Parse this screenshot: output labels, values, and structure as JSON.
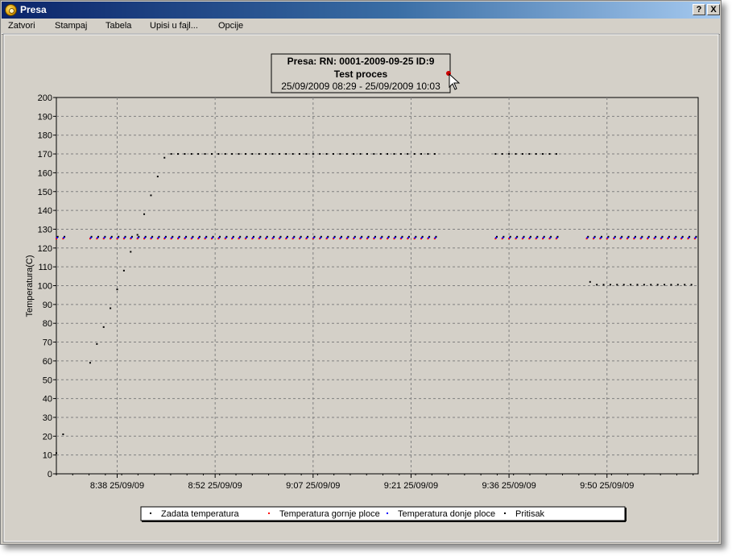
{
  "window": {
    "title": "Presa",
    "help_button": "?",
    "close_button": "X"
  },
  "menu": [
    {
      "label": "Zatvori"
    },
    {
      "label": "Stampaj"
    },
    {
      "label": "Tabela"
    },
    {
      "label": "Upisi u fajl..."
    },
    {
      "label": "Opcije"
    }
  ],
  "chart_data": {
    "type": "scatter",
    "title_lines": [
      "Presa: RN: 0001-2009-09-25 ID:9",
      "Test proces",
      "25/09/2009 08:29 - 25/09/2009 10:03"
    ],
    "ylabel": "Temperatura(C)",
    "xlabel": "",
    "ylim": [
      0,
      200
    ],
    "yticks": [
      0,
      10,
      20,
      30,
      40,
      50,
      60,
      70,
      80,
      90,
      100,
      110,
      120,
      130,
      140,
      150,
      160,
      170,
      180,
      190,
      200
    ],
    "x_axis_minutes_range": [
      509,
      604
    ],
    "xticks": [
      {
        "label": "8:38 25/09/09",
        "minute": 518
      },
      {
        "label": "8:52 25/09/09",
        "minute": 532.5
      },
      {
        "label": "9:07 25/09/09",
        "minute": 547
      },
      {
        "label": "9:21 25/09/09",
        "minute": 561.5
      },
      {
        "label": "9:36 25/09/09",
        "minute": 576
      },
      {
        "label": "9:50 25/09/09",
        "minute": 590.5
      }
    ],
    "grid": true,
    "legend_position": "bottom",
    "series": [
      {
        "name": "Zadata temperatura",
        "color": "#000000",
        "segments": [
          {
            "from": 509.2,
            "to": 510.2,
            "step": 1,
            "y": 126
          },
          {
            "from": 514.2,
            "to": 565.2,
            "step": 1,
            "y": 126
          },
          {
            "from": 574.2,
            "to": 583.2,
            "step": 1,
            "y": 126
          },
          {
            "from": 587.7,
            "to": 603.7,
            "step": 1,
            "y": 126
          }
        ]
      },
      {
        "name": "Temperatura gornje ploce",
        "color": "#ff0000",
        "segments": [
          {
            "from": 509,
            "to": 510,
            "step": 1,
            "y": 125
          },
          {
            "from": 514,
            "to": 565,
            "step": 1,
            "y": 125
          },
          {
            "from": 574,
            "to": 583,
            "step": 1,
            "y": 125
          },
          {
            "from": 587.5,
            "to": 603.5,
            "step": 1,
            "y": 125
          }
        ]
      },
      {
        "name": "Temperatura donje ploce",
        "color": "#0000ff",
        "segments": [
          {
            "from": 509.1,
            "to": 510.1,
            "step": 1,
            "y": 125.5
          },
          {
            "from": 514.1,
            "to": 565.1,
            "step": 1,
            "y": 125.5
          },
          {
            "from": 574.1,
            "to": 583.1,
            "step": 1,
            "y": 125.5
          },
          {
            "from": 587.6,
            "to": 603.6,
            "step": 1,
            "y": 125.5
          }
        ]
      },
      {
        "name": "Pritisak",
        "color": "#000000",
        "points": [
          [
            509,
            11
          ],
          [
            510,
            21
          ],
          [
            514,
            59
          ],
          [
            515,
            69
          ],
          [
            516,
            78
          ],
          [
            517,
            88
          ],
          [
            518,
            98
          ],
          [
            519,
            108
          ],
          [
            520,
            118
          ],
          [
            521,
            127
          ],
          [
            522,
            138
          ],
          [
            523,
            148
          ],
          [
            524,
            158
          ],
          [
            525,
            168
          ]
        ],
        "segments": [
          {
            "from": 526,
            "to": 565,
            "step": 1,
            "y": 170
          },
          {
            "from": 574,
            "to": 583,
            "step": 1,
            "y": 170
          },
          {
            "from": 588,
            "to": 588,
            "step": 1,
            "y": 102
          },
          {
            "from": 589,
            "to": 603,
            "step": 1,
            "y": 100.5
          }
        ]
      }
    ]
  }
}
